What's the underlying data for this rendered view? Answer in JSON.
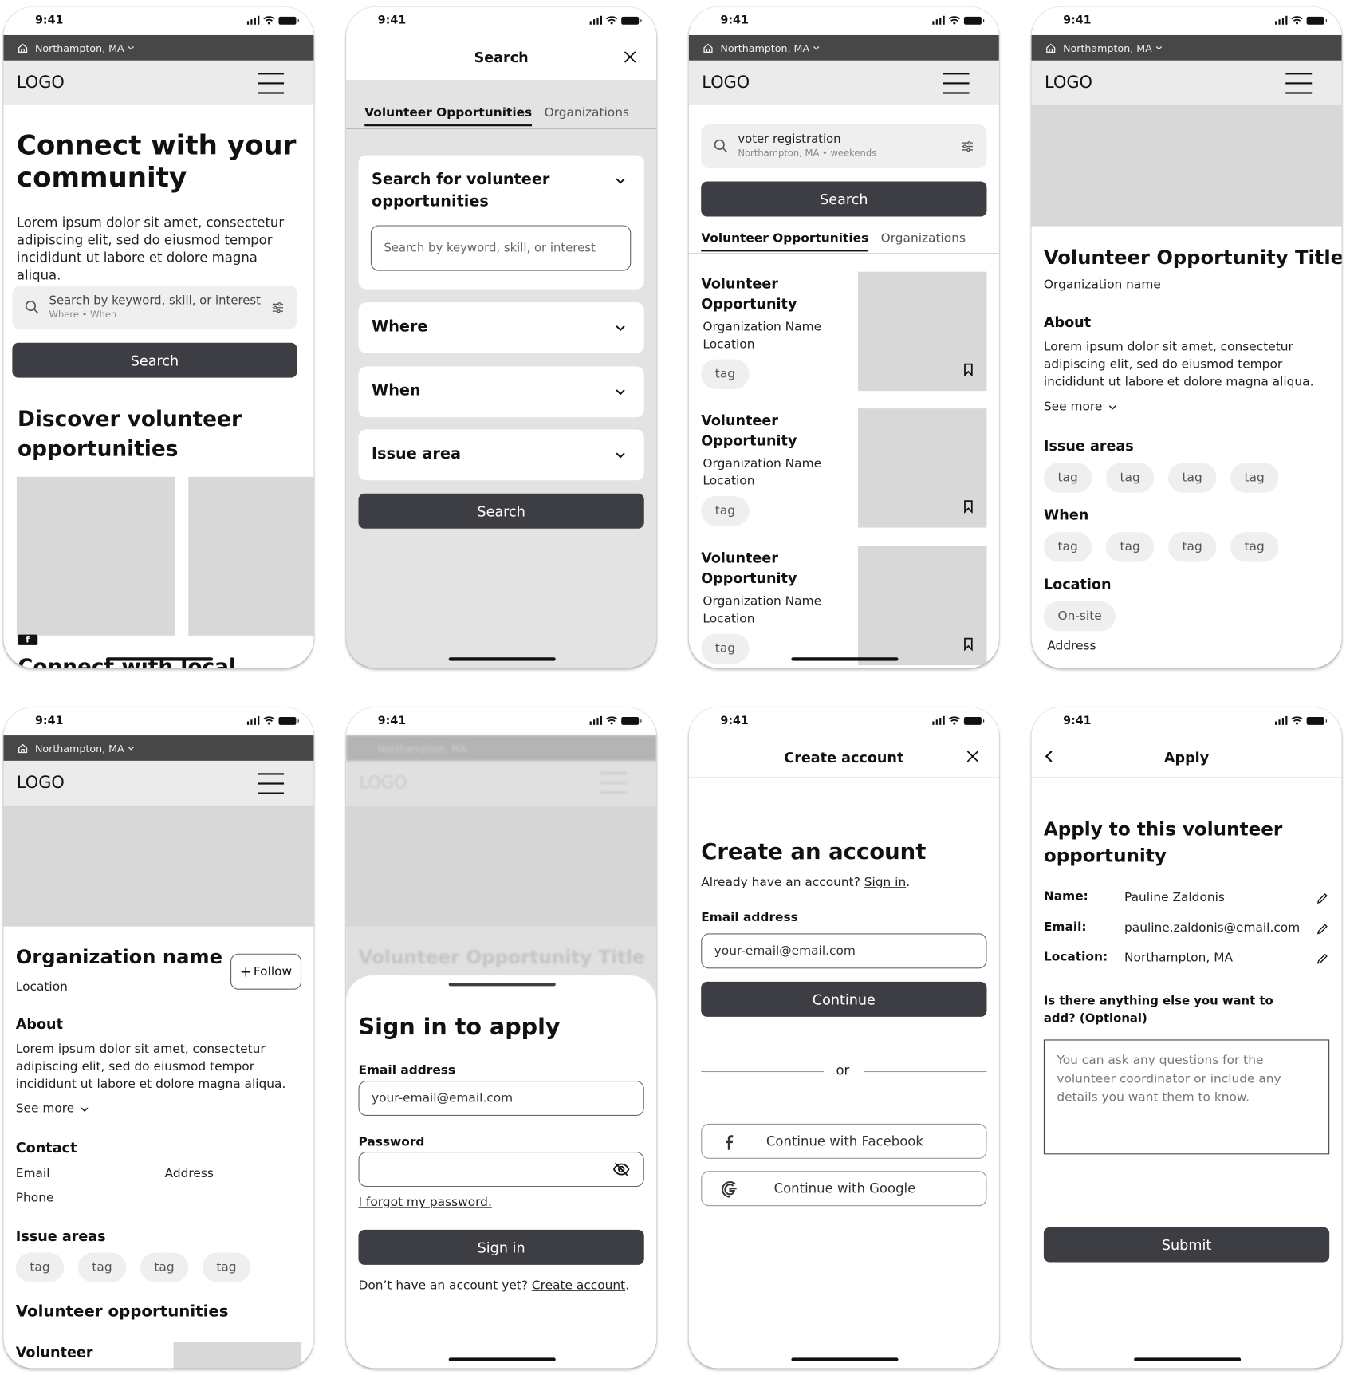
{
  "status": {
    "time": "9:41"
  },
  "common": {
    "location": "Northampton, MA",
    "logo": "LOGO",
    "lorem": "Lorem ipsum dolor sit amet, consectetur adipiscing elit, sed do eiusmod tempor incididunt ut labore et dolore magna aliqua.",
    "tag": "tag",
    "see_more": "See more"
  },
  "home": {
    "title": "Connect with your community",
    "body": "Lorem ipsum dolor sit amet, consectetur adipiscing elit, sed do eiusmod tempor incididunt ut labore et dolore magna aliqua.",
    "search_placeholder": "Search by keyword, skill, or interest",
    "search_sub": "Where • When",
    "search_button": "Search",
    "discover_title": "Discover volunteer opportunities",
    "next_section_title": "Connect with local"
  },
  "search_modal": {
    "title": "Search",
    "tabs": [
      "Volunteer Opportunities",
      "Organizations"
    ],
    "card_title": "Search for volunteer opportunities",
    "input_placeholder": "Search by keyword, skill, or interest",
    "filters": [
      "Where",
      "When",
      "Issue area"
    ],
    "search_button": "Search"
  },
  "results": {
    "query": "voter registration",
    "query_sub": "Northampton, MA  •  weekends",
    "search_button": "Search",
    "tabs": [
      "Volunteer Opportunities",
      "Organizations"
    ],
    "items": [
      {
        "title": "Volunteer Opportunity",
        "org": "Organization Name",
        "location": "Location",
        "tag": "tag"
      },
      {
        "title": "Volunteer Opportunity",
        "org": "Organization Name",
        "location": "Location",
        "tag": "tag"
      },
      {
        "title": "Volunteer Opportunity",
        "org": "Organization Name",
        "location": "Location",
        "tag": "tag"
      }
    ]
  },
  "opportunity": {
    "title": "Volunteer Opportunity Title",
    "org": "Organization name",
    "about_label": "About",
    "issue_areas_label": "Issue areas",
    "when_label": "When",
    "location_label": "Location",
    "location_tag": "On-site",
    "address": "Address"
  },
  "organization": {
    "name": "Organization name",
    "location": "Location",
    "follow_button": "Follow",
    "about_label": "About",
    "contact_label": "Contact",
    "contact": {
      "email": "Email",
      "address": "Address",
      "phone": "Phone"
    },
    "issue_areas_label": "Issue areas",
    "opps_label": "Volunteer opportunities",
    "opp_item_title": "Volunteer"
  },
  "signin": {
    "bg_title": "Volunteer Opportunity Title",
    "title": "Sign in to apply",
    "email_label": "Email address",
    "email_value": "your-email@email.com",
    "password_label": "Password",
    "password_value": "",
    "forgot": "I forgot my password.",
    "button": "Sign in",
    "no_account": "Don’t have an account yet?",
    "create_link": "Create account"
  },
  "create_account": {
    "header": "Create account",
    "title": "Create an account",
    "have_account": "Already have an account?",
    "signin_link": "Sign in",
    "email_label": "Email address",
    "email_value": "your-email@email.com",
    "continue": "Continue",
    "or": "or",
    "facebook": "Continue with Facebook",
    "google": "Continue with Google"
  },
  "apply": {
    "header": "Apply",
    "title": "Apply to this volunteer opportunity",
    "fields": [
      {
        "label": "Name:",
        "value": "Pauline Zaldonis"
      },
      {
        "label": "Email:",
        "value": "pauline.zaldonis@email.com"
      },
      {
        "label": "Location:",
        "value": "Northampton, MA"
      }
    ],
    "question": "Is there anything else you want to add? (Optional)",
    "textarea_placeholder": "You can ask any questions for the volunteer coordinator or include any details you want them to know.",
    "submit": "Submit"
  }
}
